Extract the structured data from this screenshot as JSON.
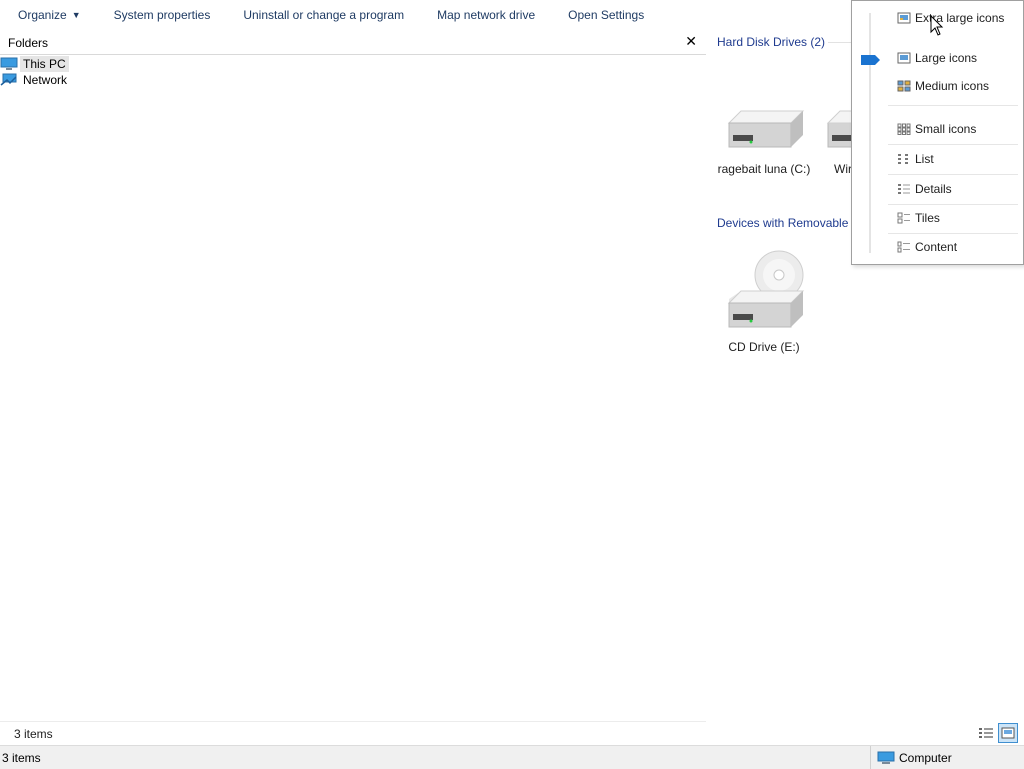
{
  "toolbar": {
    "organize": "Organize",
    "system_properties": "System properties",
    "uninstall": "Uninstall or change a program",
    "map_drive": "Map network drive",
    "open_settings": "Open Settings"
  },
  "folders": {
    "title": "Folders",
    "close": "✕",
    "items": [
      {
        "label": "This PC",
        "icon": "computer-icon"
      },
      {
        "label": "Network",
        "icon": "network-icon"
      }
    ],
    "footer_count": "3 items"
  },
  "content": {
    "hard_disk_header": "Hard Disk Drives (2)",
    "removable_header": "Devices with Removable S",
    "drives": [
      {
        "label": "ragebait luna (C:)",
        "icon": "hard-drive-icon"
      },
      {
        "label": "Wir",
        "icon": "hard-drive-icon"
      },
      {
        "label": "CD Drive (E:)",
        "icon": "cd-drive-icon"
      }
    ]
  },
  "view_menu": {
    "items": [
      {
        "label": "Extra large icons",
        "icon": "extra-large-icons-icon"
      },
      {
        "label": "Large icons",
        "icon": "large-icons-icon"
      },
      {
        "label": "Medium icons",
        "icon": "medium-icons-icon"
      },
      {
        "label": "Small icons",
        "icon": "small-icons-icon"
      },
      {
        "label": "List",
        "icon": "list-icon"
      },
      {
        "label": "Details",
        "icon": "details-icon"
      },
      {
        "label": "Tiles",
        "icon": "tiles-icon"
      },
      {
        "label": "Content",
        "icon": "content-icon"
      }
    ],
    "selected": "Large icons",
    "accent": "#1a73d0"
  },
  "status": {
    "count": "3 items",
    "zone": "Computer"
  }
}
